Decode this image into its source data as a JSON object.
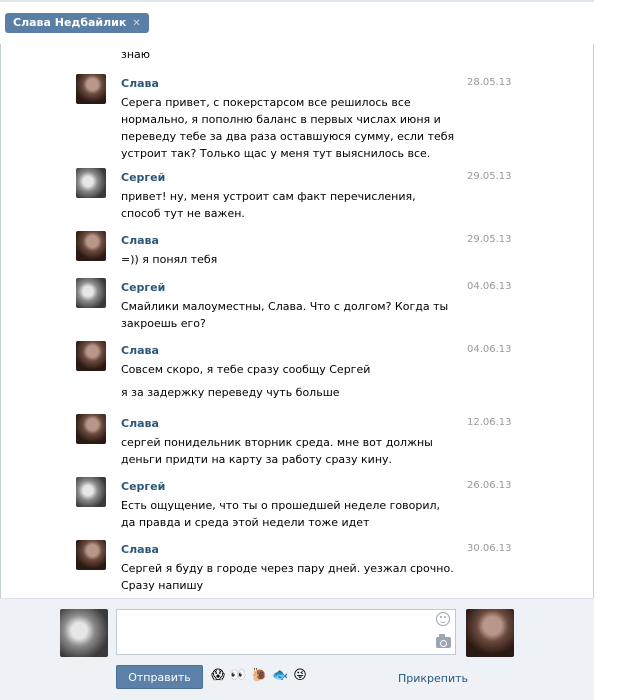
{
  "tab": {
    "title": "Слава Недбайлик",
    "close": "✕"
  },
  "partial_text": "знаю",
  "messages": [
    {
      "author": "Слава",
      "avatar": "slava",
      "date": "28.05.13",
      "text": "Серега привет, с покерстарсом все решилось все нормально, я пополню баланс в первых числах июня и переведу тебе за два раза оставшуюся сумму, если тебя устроит так? Только щас у меня тут выяснилось все."
    },
    {
      "author": "Сергей",
      "avatar": "sergey",
      "date": "29.05.13",
      "text": "привет! ну, меня устроит сам факт перечисления, способ тут не важен."
    },
    {
      "author": "Слава",
      "avatar": "slava",
      "date": "29.05.13",
      "text": "=)) я понял тебя"
    },
    {
      "author": "Сергей",
      "avatar": "sergey",
      "date": "04.06.13",
      "text": "Смайлики малоуместны, Слава. Что с долгом? Когда ты закроешь его?"
    },
    {
      "author": "Слава",
      "avatar": "slava",
      "date": "04.06.13",
      "text": "Совсем скоро, я тебе сразу сообщу Сергей",
      "extra": "я за задержку переведу чуть больше"
    },
    {
      "author": "Слава",
      "avatar": "slava",
      "date": "12.06.13",
      "text": "сергей понидельник вторник среда. мне вот должны деньги придти на карту за работу сразу кину."
    },
    {
      "author": "Сергей",
      "avatar": "sergey",
      "date": "26.06.13",
      "text": "Есть ощущение, что ты о прошедшей неделе говорил, да правда и среда этой недели тоже идет"
    },
    {
      "author": "Слава",
      "avatar": "slava",
      "date": "30.06.13",
      "text": "Сергей я буду в городе через пару дней. уезжал срочно. Сразу напишу"
    }
  ],
  "composer": {
    "value": "",
    "send_label": "Отправить",
    "attach_label": "Прикрепить",
    "emojis": [
      "😱",
      "👀",
      "🐌",
      "🐟",
      "😜"
    ]
  }
}
